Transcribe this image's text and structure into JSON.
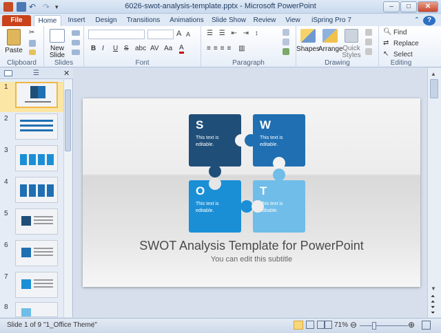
{
  "window": {
    "title": "6026-swot-analysis-template.pptx - Microsoft PowerPoint"
  },
  "tabs": [
    {
      "label": "File"
    },
    {
      "label": "Home"
    },
    {
      "label": "Insert"
    },
    {
      "label": "Design"
    },
    {
      "label": "Transitions"
    },
    {
      "label": "Animations"
    },
    {
      "label": "Slide Show"
    },
    {
      "label": "Review"
    },
    {
      "label": "View"
    },
    {
      "label": "iSpring Pro 7"
    }
  ],
  "ribbon": {
    "clipboard": {
      "label": "Clipboard",
      "paste": "Paste"
    },
    "slides": {
      "label": "Slides",
      "new_slide": "New Slide"
    },
    "font": {
      "label": "Font",
      "bold": "B",
      "italic": "I",
      "underline": "U",
      "strike": "S",
      "shadow": "abc",
      "spacing": "AV",
      "case": "Aa",
      "color": "A",
      "grow": "A",
      "shrink": "A"
    },
    "paragraph": {
      "label": "Paragraph"
    },
    "drawing": {
      "label": "Drawing",
      "shapes": "Shapes",
      "arrange": "Arrange",
      "quick_styles": "Quick Styles"
    },
    "editing": {
      "label": "Editing",
      "find": "Find",
      "replace": "Replace",
      "select": "Select"
    }
  },
  "slide_panel": {
    "slides": [
      {
        "num": "1"
      },
      {
        "num": "2"
      },
      {
        "num": "3"
      },
      {
        "num": "4"
      },
      {
        "num": "5"
      },
      {
        "num": "6"
      },
      {
        "num": "7"
      },
      {
        "num": "8"
      }
    ]
  },
  "slide": {
    "s": {
      "letter": "S",
      "text": "This text is editable."
    },
    "w": {
      "letter": "W",
      "text": "This text is editable."
    },
    "o": {
      "letter": "O",
      "text": "This text is editable."
    },
    "t": {
      "letter": "T",
      "text": "This text is editable."
    },
    "title": "SWOT Analysis Template for PowerPoint",
    "subtitle": "You can edit this subtitle"
  },
  "status": {
    "slide_info": "Slide 1 of 9",
    "theme": "\"1_Office Theme\"",
    "zoom": "71%"
  },
  "colors": {
    "s": "#1f4e79",
    "w": "#1f6fb2",
    "o": "#1b8fd6",
    "t": "#6fbde8",
    "file_tab": "#c9421a"
  }
}
